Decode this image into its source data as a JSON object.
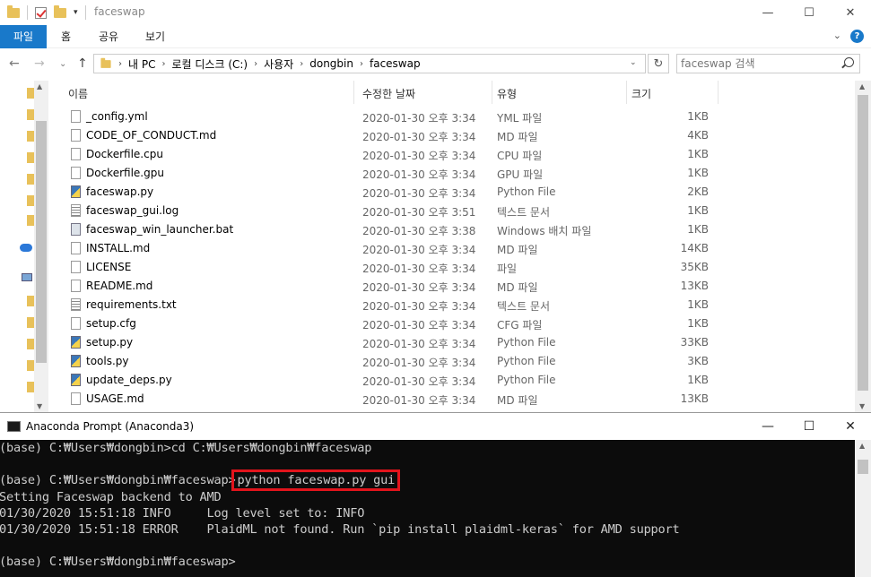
{
  "explorer": {
    "title": "faceswap",
    "window_controls": [
      "—",
      "☐",
      "✕"
    ],
    "ribbon_tabs": [
      "파일",
      "홈",
      "공유",
      "보기"
    ],
    "breadcrumb": [
      "내 PC",
      "로컬 디스크 (C:)",
      "사용자",
      "dongbin",
      "faceswap"
    ],
    "search_placeholder": "faceswap 검색",
    "columns": [
      "이름",
      "수정한 날짜",
      "유형",
      "크기"
    ],
    "files": [
      {
        "name": "_config.yml",
        "date": "2020-01-30 오후 3:34",
        "type": "YML 파일",
        "size": "1KB",
        "icon": "file"
      },
      {
        "name": "CODE_OF_CONDUCT.md",
        "date": "2020-01-30 오후 3:34",
        "type": "MD 파일",
        "size": "4KB",
        "icon": "file"
      },
      {
        "name": "Dockerfile.cpu",
        "date": "2020-01-30 오후 3:34",
        "type": "CPU 파일",
        "size": "1KB",
        "icon": "file"
      },
      {
        "name": "Dockerfile.gpu",
        "date": "2020-01-30 오후 3:34",
        "type": "GPU 파일",
        "size": "1KB",
        "icon": "file"
      },
      {
        "name": "faceswap.py",
        "date": "2020-01-30 오후 3:34",
        "type": "Python File",
        "size": "2KB",
        "icon": "py"
      },
      {
        "name": "faceswap_gui.log",
        "date": "2020-01-30 오후 3:51",
        "type": "텍스트 문서",
        "size": "1KB",
        "icon": "log"
      },
      {
        "name": "faceswap_win_launcher.bat",
        "date": "2020-01-30 오후 3:38",
        "type": "Windows 배치 파일",
        "size": "1KB",
        "icon": "bat"
      },
      {
        "name": "INSTALL.md",
        "date": "2020-01-30 오후 3:34",
        "type": "MD 파일",
        "size": "14KB",
        "icon": "file"
      },
      {
        "name": "LICENSE",
        "date": "2020-01-30 오후 3:34",
        "type": "파일",
        "size": "35KB",
        "icon": "file"
      },
      {
        "name": "README.md",
        "date": "2020-01-30 오후 3:34",
        "type": "MD 파일",
        "size": "13KB",
        "icon": "file"
      },
      {
        "name": "requirements.txt",
        "date": "2020-01-30 오후 3:34",
        "type": "텍스트 문서",
        "size": "1KB",
        "icon": "log"
      },
      {
        "name": "setup.cfg",
        "date": "2020-01-30 오후 3:34",
        "type": "CFG 파일",
        "size": "1KB",
        "icon": "file"
      },
      {
        "name": "setup.py",
        "date": "2020-01-30 오후 3:34",
        "type": "Python File",
        "size": "33KB",
        "icon": "py"
      },
      {
        "name": "tools.py",
        "date": "2020-01-30 오후 3:34",
        "type": "Python File",
        "size": "3KB",
        "icon": "py"
      },
      {
        "name": "update_deps.py",
        "date": "2020-01-30 오후 3:34",
        "type": "Python File",
        "size": "1KB",
        "icon": "py"
      },
      {
        "name": "USAGE.md",
        "date": "2020-01-30 오후 3:34",
        "type": "MD 파일",
        "size": "13KB",
        "icon": "file"
      }
    ]
  },
  "prompt": {
    "title": "Anaconda Prompt (Anaconda3)",
    "window_controls": [
      "—",
      "☐",
      "✕"
    ],
    "lines": [
      {
        "prefix": "(base) C:₩Users₩dongbin>cd C:₩Users₩dongbin₩faceswap",
        "highlight": ""
      },
      {
        "prefix": "",
        "highlight": ""
      },
      {
        "prefix": "(base) C:₩Users₩dongbin₩faceswap>",
        "highlight": "python faceswap.py gui"
      },
      {
        "prefix": "Setting Faceswap backend to AMD",
        "highlight": ""
      },
      {
        "prefix": "01/30/2020 15:51:18 INFO     Log level set to: INFO",
        "highlight": ""
      },
      {
        "prefix": "01/30/2020 15:51:18 ERROR    PlaidML not found. Run `pip install plaidml-keras` for AMD support",
        "highlight": ""
      },
      {
        "prefix": "",
        "highlight": ""
      },
      {
        "prefix": "(base) C:₩Users₩dongbin₩faceswap>",
        "highlight": ""
      }
    ]
  }
}
